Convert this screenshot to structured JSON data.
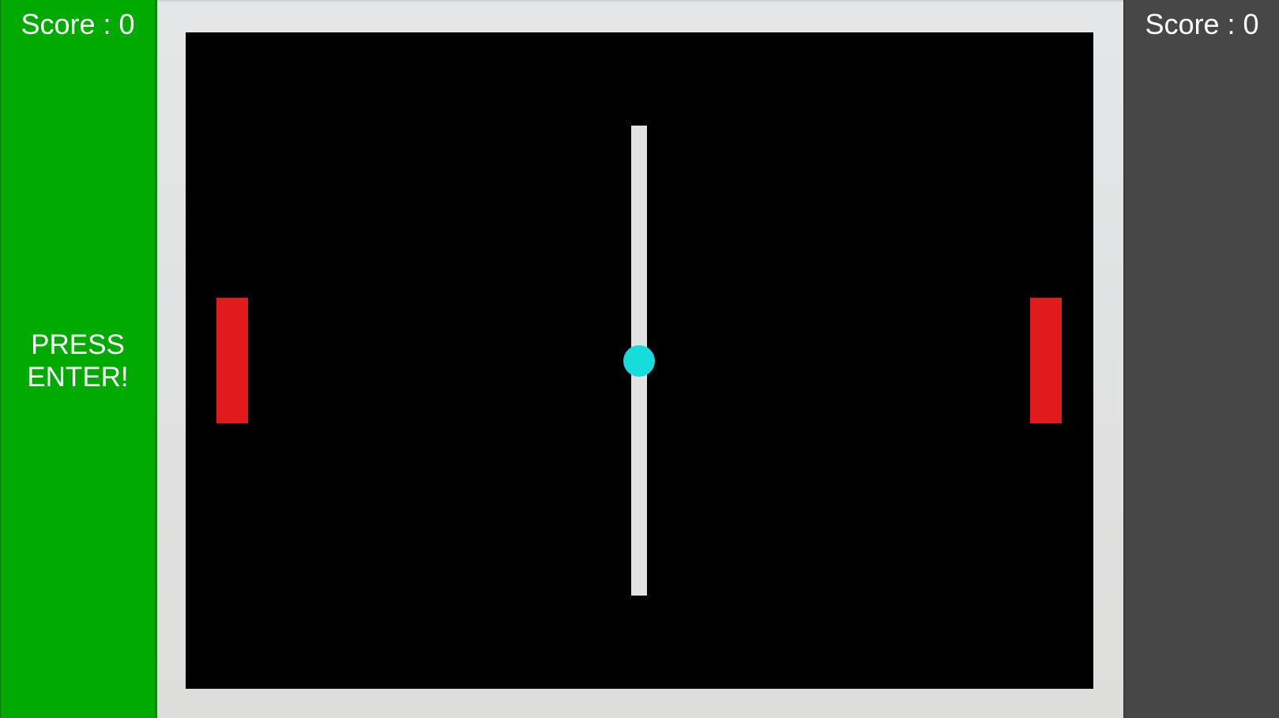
{
  "player_left": {
    "score_text": "Score : 0",
    "prompt": "PRESS\nENTER!",
    "panel_color": "#00aa00"
  },
  "player_right": {
    "score_text": "Score : 0",
    "panel_color": "#474747"
  },
  "court": {
    "paddle_color": "#e11b1b",
    "ball_color": "#16dcdc",
    "net_color": "#e3e3e3"
  }
}
